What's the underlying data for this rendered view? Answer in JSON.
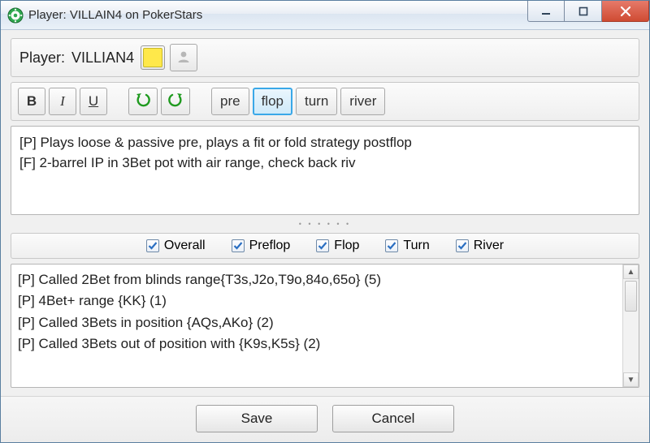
{
  "window": {
    "title": "Player: VILLAIN4 on PokerStars"
  },
  "player": {
    "label": "Player:",
    "name": "VILLIAN4",
    "color": "#ffe84a"
  },
  "toolbar": {
    "bold": "B",
    "italic": "I",
    "underline": "U",
    "streets": {
      "pre": "pre",
      "flop": "flop",
      "turn": "turn",
      "river": "river",
      "active": "flop"
    }
  },
  "notes": [
    "[P] Plays loose & passive pre, plays a fit or fold strategy postflop",
    "[F] 2-barrel IP in 3Bet pot with air range, check back riv"
  ],
  "filters": {
    "overall": {
      "label": "Overall",
      "checked": true
    },
    "preflop": {
      "label": "Preflop",
      "checked": true
    },
    "flop": {
      "label": "Flop",
      "checked": true
    },
    "turn": {
      "label": "Turn",
      "checked": true
    },
    "river": {
      "label": "River",
      "checked": true
    }
  },
  "list": [
    "[P] Called 2Bet from blinds range{T3s,J2o,T9o,84o,65o} (5)",
    "[P] 4Bet+ range {KK} (1)",
    "[P] Called 3Bets in position {AQs,AKo} (2)",
    "[P] Called 3Bets out of position with {K9s,K5s} (2)"
  ],
  "footer": {
    "save": "Save",
    "cancel": "Cancel"
  }
}
